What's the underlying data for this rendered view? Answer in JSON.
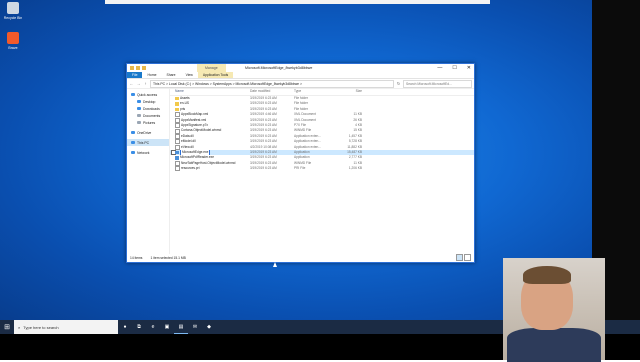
{
  "desktop": {
    "icons": [
      {
        "label": "Recycle Bin",
        "icon": "recycle-bin-icon"
      },
      {
        "label": "Brave",
        "icon": "brave-icon"
      }
    ]
  },
  "window": {
    "manage_tab": "Manage",
    "title": "Microsoft.MicrosoftEdge_8wekyb3d8bbwe",
    "controls": {
      "minimize": "—",
      "maximize": "☐",
      "close": "✕"
    },
    "ribbon_tabs": [
      "File",
      "Home",
      "Share",
      "View",
      "Application Tools"
    ],
    "address": {
      "path": "This PC  >  Local Disk (C:)  >  Windows  >  SystemApps  >  Microsoft.MicrosoftEdge_8wekyb3d8bbwe  >",
      "search_placeholder": "Search Microsoft.MicrosoftEd..."
    },
    "nav": [
      {
        "label": "Quick access",
        "icon": "star-icon",
        "color": "#3a8ee6",
        "level": 0
      },
      {
        "label": "Desktop",
        "icon": "desktop-icon",
        "color": "#3a8ee6",
        "level": 1
      },
      {
        "label": "Downloads",
        "icon": "download-icon",
        "color": "#3a8ee6",
        "level": 1
      },
      {
        "label": "Documents",
        "icon": "documents-icon",
        "color": "#9aa6b4",
        "level": 1
      },
      {
        "label": "Pictures",
        "icon": "pictures-icon",
        "color": "#9aa6b4",
        "level": 1
      },
      {
        "label": "OneDrive",
        "icon": "cloud-icon",
        "color": "#3a8ee6",
        "level": 0
      },
      {
        "label": "This PC",
        "icon": "computer-icon",
        "color": "#3a8ee6",
        "level": 0,
        "selected": true
      },
      {
        "label": "Network",
        "icon": "network-icon",
        "color": "#3a8ee6",
        "level": 0
      }
    ],
    "columns": {
      "name": "Name",
      "date": "Date modified",
      "type": "Type",
      "size": "Size"
    },
    "files": [
      {
        "name": "Assets",
        "date": "3/19/2019 6:23 AM",
        "type": "File folder",
        "size": "",
        "kind": "folder"
      },
      {
        "name": "en-US",
        "date": "3/19/2019 6:23 AM",
        "type": "File folder",
        "size": "",
        "kind": "folder"
      },
      {
        "name": "pris",
        "date": "3/19/2019 6:23 AM",
        "type": "File folder",
        "size": "",
        "kind": "folder"
      },
      {
        "name": "AppxBlockMap.xml",
        "date": "3/19/2019 4:46 AM",
        "type": "XML Document",
        "size": "11 KB",
        "kind": "file"
      },
      {
        "name": "AppxManifest.xml",
        "date": "3/19/2019 6:23 AM",
        "type": "XML Document",
        "size": "26 KB",
        "kind": "file"
      },
      {
        "name": "AppxSignature.p7x",
        "date": "3/19/2019 6:23 AM",
        "type": "P7X File",
        "size": "4 KB",
        "kind": "file"
      },
      {
        "name": "Cortana.ObjectModel.winmd",
        "date": "3/19/2019 6:23 AM",
        "type": "WINMD File",
        "size": "15 KB",
        "kind": "file"
      },
      {
        "name": "eData.dll",
        "date": "3/19/2019 6:23 AM",
        "type": "Application exten...",
        "size": "1,457 KB",
        "kind": "file"
      },
      {
        "name": "eModel.dll",
        "date": "3/19/2019 6:23 AM",
        "type": "Application exten...",
        "size": "5,728 KB",
        "kind": "file"
      },
      {
        "name": "eView.dll",
        "date": "4/2/2019 10:08 AM",
        "type": "Application exten...",
        "size": "11,882 KB",
        "kind": "file"
      },
      {
        "name": "MicrosoftEdge.exe",
        "date": "3/19/2019 6:23 AM",
        "type": "Application",
        "size": "15,487 KB",
        "kind": "app",
        "selected": true,
        "renaming": true
      },
      {
        "name": "MicrosoftPdfReader.exe",
        "date": "3/19/2019 6:23 AM",
        "type": "Application",
        "size": "2,777 KB",
        "kind": "app"
      },
      {
        "name": "NewTabPageHost.ObjectModel.winmd",
        "date": "3/19/2019 6:23 AM",
        "type": "WINMD File",
        "size": "11 KB",
        "kind": "file"
      },
      {
        "name": "resources.pri",
        "date": "3/19/2019 6:23 AM",
        "type": "PRI File",
        "size": "1,206 KB",
        "kind": "file"
      }
    ],
    "status": {
      "count": "14 items",
      "selected": "1 item selected  15.1 MB"
    }
  },
  "taskbar": {
    "start_icon": "windows-logo-icon",
    "search_placeholder": "Type here to search",
    "items": [
      {
        "name": "mic-icon",
        "glyph": "●"
      },
      {
        "name": "task-view-icon",
        "glyph": "⧉"
      },
      {
        "name": "edge-icon",
        "glyph": "e"
      },
      {
        "name": "store-icon",
        "glyph": "▣"
      },
      {
        "name": "file-explorer-icon",
        "glyph": "▤",
        "active": true
      },
      {
        "name": "mail-icon",
        "glyph": "✉"
      },
      {
        "name": "brave-taskbar-icon",
        "glyph": "◆"
      }
    ]
  },
  "colors": {
    "accent": "#1979ca",
    "selection": "#cce8ff",
    "taskbar": "#1b2b44"
  }
}
